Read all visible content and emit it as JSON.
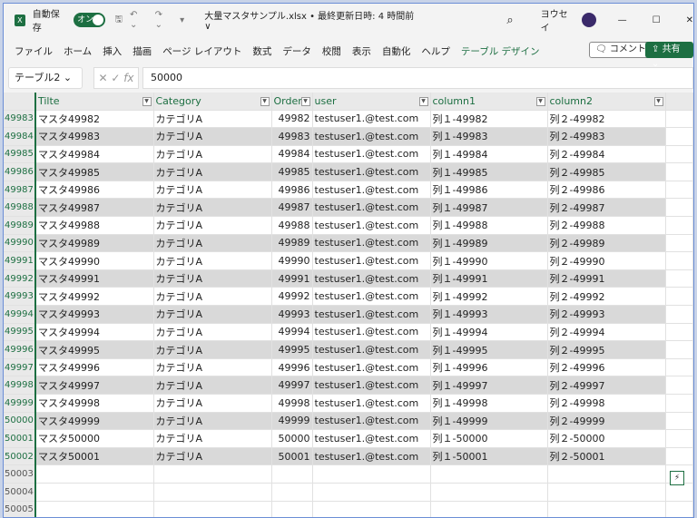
{
  "titlebar": {
    "autosave": "自動保存",
    "toggle": "オン",
    "filename": "大量マスタサンプル.xlsx • 最終更新日時: 4 時間前 ∨",
    "user": "ヨウセイ"
  },
  "ribbon": {
    "tabs": [
      "ファイル",
      "ホーム",
      "挿入",
      "描画",
      "ページ レイアウト",
      "数式",
      "データ",
      "校閲",
      "表示",
      "自動化",
      "ヘルプ",
      "テーブル デザイン"
    ],
    "comment": "コメント",
    "share": "共有"
  },
  "formula": {
    "name_box": "テーブル2",
    "value": "50000"
  },
  "columns": [
    "Tilte",
    "Category",
    "Order",
    "user",
    "column1",
    "column2"
  ],
  "rows": [
    [
      "49983",
      "マスタ49982",
      "カテゴリA",
      "49982",
      "testuser1.@test.com",
      "列１-49982",
      "列２-49982"
    ],
    [
      "49984",
      "マスタ49983",
      "カテゴリA",
      "49983",
      "testuser1.@test.com",
      "列１-49983",
      "列２-49983"
    ],
    [
      "49985",
      "マスタ49984",
      "カテゴリA",
      "49984",
      "testuser1.@test.com",
      "列１-49984",
      "列２-49984"
    ],
    [
      "49986",
      "マスタ49985",
      "カテゴリA",
      "49985",
      "testuser1.@test.com",
      "列１-49985",
      "列２-49985"
    ],
    [
      "49987",
      "マスタ49986",
      "カテゴリA",
      "49986",
      "testuser1.@test.com",
      "列１-49986",
      "列２-49986"
    ],
    [
      "49988",
      "マスタ49987",
      "カテゴリA",
      "49987",
      "testuser1.@test.com",
      "列１-49987",
      "列２-49987"
    ],
    [
      "49989",
      "マスタ49988",
      "カテゴリA",
      "49988",
      "testuser1.@test.com",
      "列１-49988",
      "列２-49988"
    ],
    [
      "49990",
      "マスタ49989",
      "カテゴリA",
      "49989",
      "testuser1.@test.com",
      "列１-49989",
      "列２-49989"
    ],
    [
      "49991",
      "マスタ49990",
      "カテゴリA",
      "49990",
      "testuser1.@test.com",
      "列１-49990",
      "列２-49990"
    ],
    [
      "49992",
      "マスタ49991",
      "カテゴリA",
      "49991",
      "testuser1.@test.com",
      "列１-49991",
      "列２-49991"
    ],
    [
      "49993",
      "マスタ49992",
      "カテゴリA",
      "49992",
      "testuser1.@test.com",
      "列１-49992",
      "列２-49992"
    ],
    [
      "49994",
      "マスタ49993",
      "カテゴリA",
      "49993",
      "testuser1.@test.com",
      "列１-49993",
      "列２-49993"
    ],
    [
      "49995",
      "マスタ49994",
      "カテゴリA",
      "49994",
      "testuser1.@test.com",
      "列１-49994",
      "列２-49994"
    ],
    [
      "49996",
      "マスタ49995",
      "カテゴリA",
      "49995",
      "testuser1.@test.com",
      "列１-49995",
      "列２-49995"
    ],
    [
      "49997",
      "マスタ49996",
      "カテゴリA",
      "49996",
      "testuser1.@test.com",
      "列１-49996",
      "列２-49996"
    ],
    [
      "49998",
      "マスタ49997",
      "カテゴリA",
      "49997",
      "testuser1.@test.com",
      "列１-49997",
      "列２-49997"
    ],
    [
      "49999",
      "マスタ49998",
      "カテゴリA",
      "49998",
      "testuser1.@test.com",
      "列１-49998",
      "列２-49998"
    ],
    [
      "50000",
      "マスタ49999",
      "カテゴリA",
      "49999",
      "testuser1.@test.com",
      "列１-49999",
      "列２-49999"
    ],
    [
      "50001",
      "マスタ50000",
      "カテゴリA",
      "50000",
      "testuser1.@test.com",
      "列１-50000",
      "列２-50000"
    ],
    [
      "50002",
      "マスタ50001",
      "カテゴリA",
      "50001",
      "testuser1.@test.com",
      "列１-50001",
      "列２-50001"
    ]
  ],
  "empty_rows": [
    "50003",
    "50004",
    "50005"
  ],
  "colors": {
    "accent": "#1d6f42",
    "band": "#d9d9d9"
  }
}
